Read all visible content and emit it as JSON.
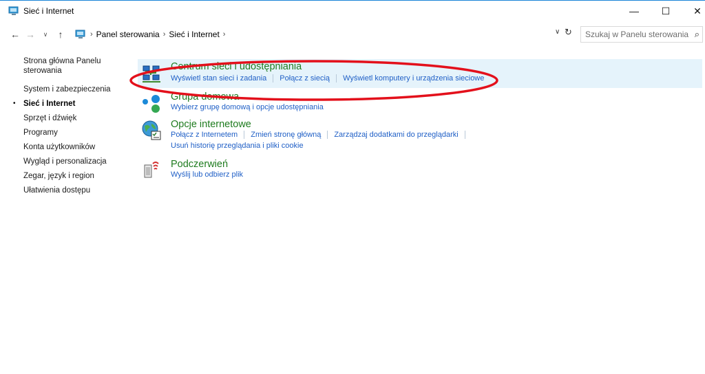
{
  "window": {
    "title": "Sieć i Internet",
    "min_glyph": "—",
    "max_glyph": "☐",
    "close_glyph": "✕"
  },
  "nav": {
    "back_glyph": "←",
    "forward_glyph": "→",
    "recent_glyph": "∨",
    "up_glyph": "↑",
    "breadcrumb": [
      "Panel sterowania",
      "Sieć i Internet"
    ],
    "dropdown_glyph": "∨",
    "refresh_glyph": "↻",
    "search_placeholder": "Szukaj w Panelu sterowania",
    "search_glyph": "⌕"
  },
  "sidebar": {
    "items": [
      {
        "label": "Strona główna Panelu"
      },
      {
        "label": "sterowania"
      },
      {
        "label": "System i zabezpieczenia"
      },
      {
        "label": "Sieć i Internet"
      },
      {
        "label": "Sprzęt i dźwięk"
      },
      {
        "label": "Programy"
      },
      {
        "label": "Konta użytkowników"
      },
      {
        "label": "Wygląd i personalizacja"
      },
      {
        "label": "Zegar, język i region"
      },
      {
        "label": "Ułatwienia dostępu"
      }
    ],
    "active_marker": "•"
  },
  "main": {
    "categories": [
      {
        "title": "Centrum sieci i udostępniania",
        "icon": "network-center-icon",
        "links": [
          "Wyświetl stan sieci i zadania",
          "Połącz z siecią",
          "Wyświetl komputery i urządzenia sieciowe"
        ]
      },
      {
        "title": "Grupa domowa",
        "icon": "homegroup-icon",
        "links": [
          "Wybierz grupę domową i opcje udostępniania"
        ]
      },
      {
        "title": "Opcje internetowe",
        "icon": "internet-options-icon",
        "links": [
          "Połącz z Internetem",
          "Zmień stronę główną",
          "Zarządzaj dodatkami do przeglądarki"
        ],
        "links2": [
          "Usuń historię przeglądania i pliki cookie"
        ]
      },
      {
        "title": "Podczerwień",
        "icon": "infrared-icon",
        "links": [
          "Wyślij lub odbierz plik"
        ]
      }
    ]
  },
  "colors": {
    "title_green": "#1e7b1e",
    "link_blue": "#1f5fc6",
    "selection": "#e5f3fb",
    "annotation_red": "#e3101b"
  }
}
